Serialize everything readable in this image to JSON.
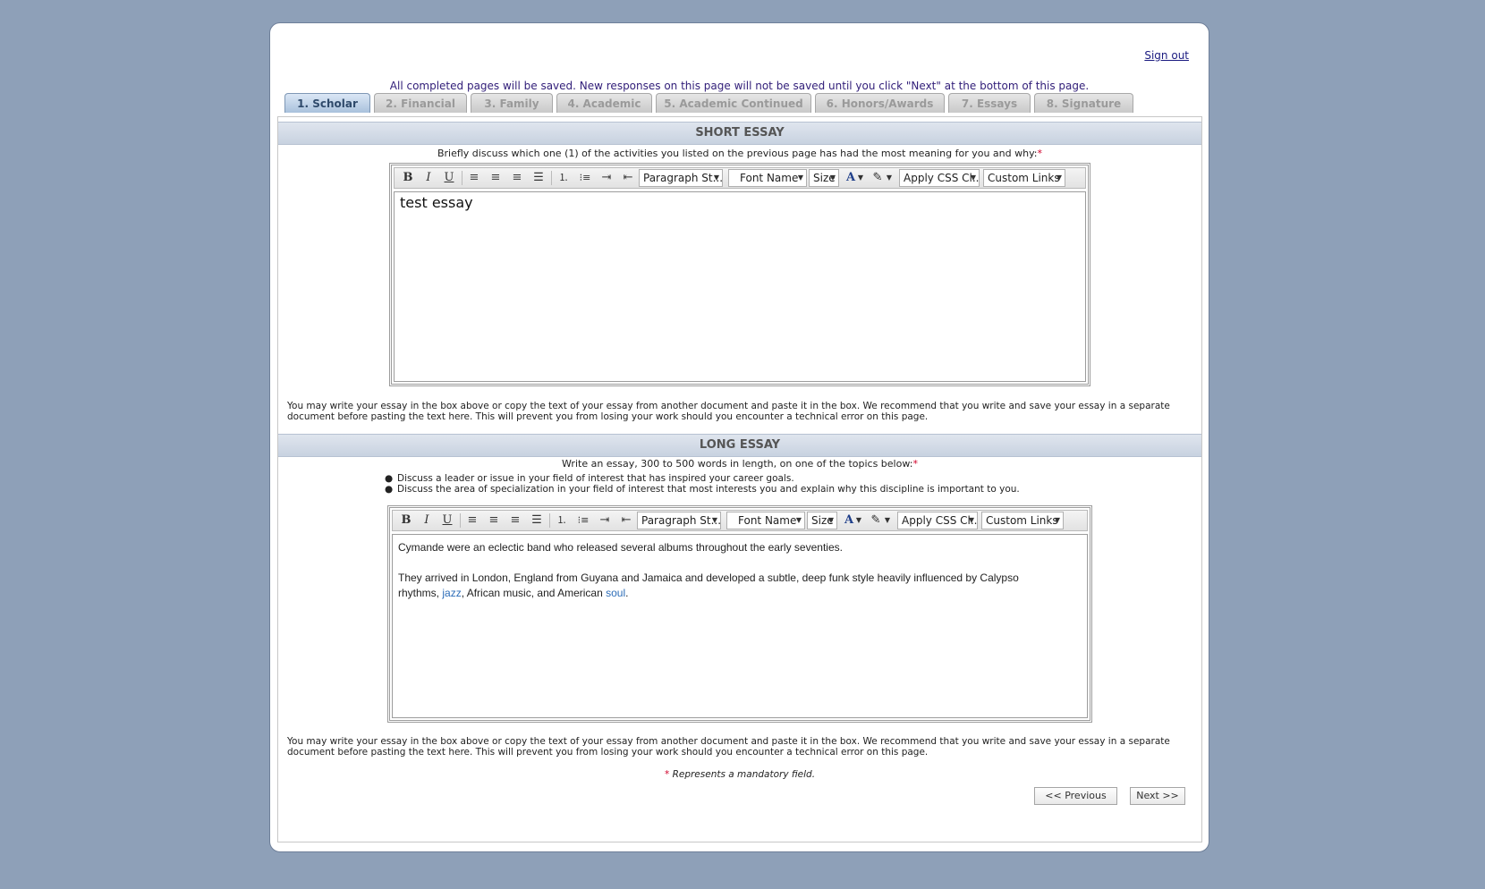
{
  "header": {
    "sign_out": "Sign out",
    "save_note": "All completed pages will be saved. New responses on this page will not be saved until you click \"Next\" at the bottom of this page."
  },
  "tabs": [
    {
      "label": "1. Scholar",
      "active": true
    },
    {
      "label": "2. Financial",
      "active": false
    },
    {
      "label": "3. Family",
      "active": false
    },
    {
      "label": "4. Academic",
      "active": false
    },
    {
      "label": "5. Academic Continued",
      "active": false
    },
    {
      "label": "6. Honors/Awards",
      "active": false
    },
    {
      "label": "7. Essays",
      "active": false
    },
    {
      "label": "8. Signature",
      "active": false
    }
  ],
  "toolbar": {
    "bold": "B",
    "italic": "I",
    "underline": "U",
    "paragraph_style": "Paragraph St...",
    "font_name": "Font Name",
    "size": "Size",
    "font_color": "A",
    "apply_css": "Apply CSS Cl...",
    "custom_links": "Custom Links"
  },
  "short_essay": {
    "title": "SHORT ESSAY",
    "prompt": "Briefly discuss which one (1) of the activities you listed on the previous page has had the most meaning for you and why:",
    "content": "test essay",
    "hint": "You may write your essay in the box above or copy the text of your essay from another document and paste it in the box. We recommend that you write and save your essay in a separate document before pasting the text here. This will prevent you from losing your work should you encounter a technical error on this page."
  },
  "long_essay": {
    "title": "LONG ESSAY",
    "prompt": "Write an essay, 300 to 500 words in length, on one of the topics below:",
    "topics": [
      "Discuss a leader or issue in your field of interest that has inspired your career goals.",
      "Discuss the area of specialization in your field of interest that most interests you and explain why this discipline is important to you."
    ],
    "paragraph1": "Cymande were an eclectic band who released several albums throughout the early seventies.",
    "paragraph2_start": "They arrived in London, England from Guyana and Jamaica and developed a subtle, deep funk style heavily influenced by Calypso rhythms,",
    "link1": "jazz",
    "paragraph2_mid": ", African music, and American",
    "link2": "soul",
    "paragraph2_end": ".",
    "hint": "You may write your essay in the box above or copy the text of your essay from another document and paste it in the box. We recommend that you write and save your essay in a separate document before pasting the text here. This will prevent you from losing your work should you encounter a technical error on this page."
  },
  "footer": {
    "asterisk": "*",
    "mandatory_note": "Represents a mandatory field.",
    "previous": "<< Previous",
    "next": "Next >>"
  },
  "colors": {
    "page_background": "#8ea0b8",
    "active_tab": "#a9c1dc",
    "required": "#d0002a",
    "link": "#2d6db8"
  }
}
